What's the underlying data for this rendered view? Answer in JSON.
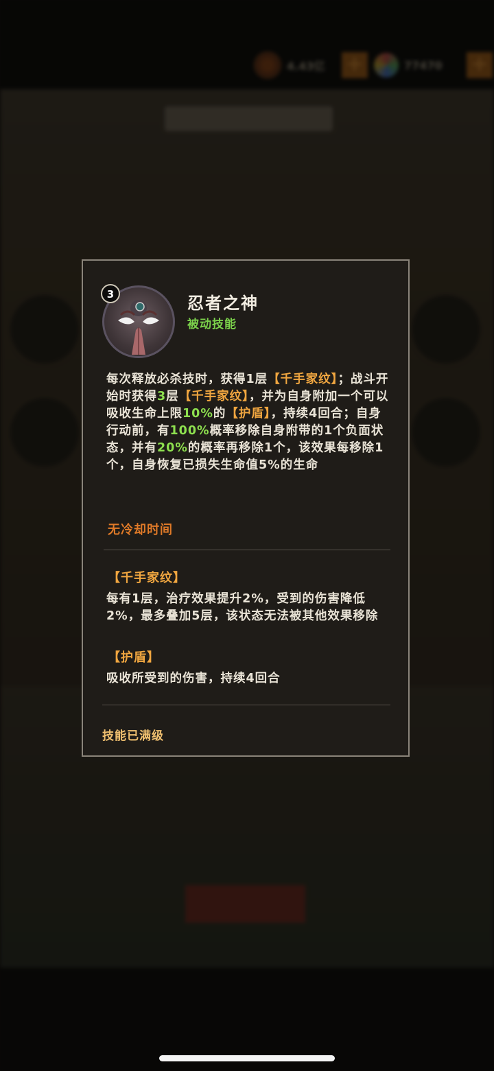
{
  "resources": {
    "coins": "4.43亿",
    "gems": "77470",
    "plus_symbol": "+"
  },
  "skill": {
    "level": "3",
    "name": "忍者之神",
    "type": "被动技能",
    "description": [
      {
        "t": "每次释放必杀技时，获得1层",
        "c": "text"
      },
      {
        "t": "【千手家纹】",
        "c": "tag"
      },
      {
        "t": "；战斗开始时获得",
        "c": "text"
      },
      {
        "t": "3",
        "c": "num"
      },
      {
        "t": "层",
        "c": "text"
      },
      {
        "t": "【千手家纹】",
        "c": "tag"
      },
      {
        "t": "，并为自身附加一个可以吸收生命上限",
        "c": "text"
      },
      {
        "t": "10%",
        "c": "num"
      },
      {
        "t": "的",
        "c": "text"
      },
      {
        "t": "【护盾】",
        "c": "tag"
      },
      {
        "t": "，持续4回合；自身行动前，有",
        "c": "text"
      },
      {
        "t": "100%",
        "c": "num"
      },
      {
        "t": "概率移除自身附带的1个负面状态，并有",
        "c": "text"
      },
      {
        "t": "20%",
        "c": "num"
      },
      {
        "t": "的概率再移除1个，该效果每移除1个，自身恢复已损失生命值5%的生命",
        "c": "text"
      }
    ],
    "cooldown": "无冷却时间",
    "effects": [
      {
        "title": "【千手家纹】",
        "text": "每有1层，治疗效果提升2%，受到的伤害降低2%，最多叠加5层，该状态无法被其他效果移除"
      },
      {
        "title": "【护盾】",
        "text": "吸收所受到的伤害，持续4回合"
      }
    ],
    "max_level_text": "技能已满级"
  },
  "colors": {
    "tag": "#f0a640",
    "number": "#8ee04f",
    "passive": "#7bd14b",
    "cooldown": "#e07a28",
    "border": "#8a847a"
  },
  "icons": {
    "coin": "coin-icon",
    "gem": "gem-icon",
    "portrait": "hashirama-portrait"
  }
}
